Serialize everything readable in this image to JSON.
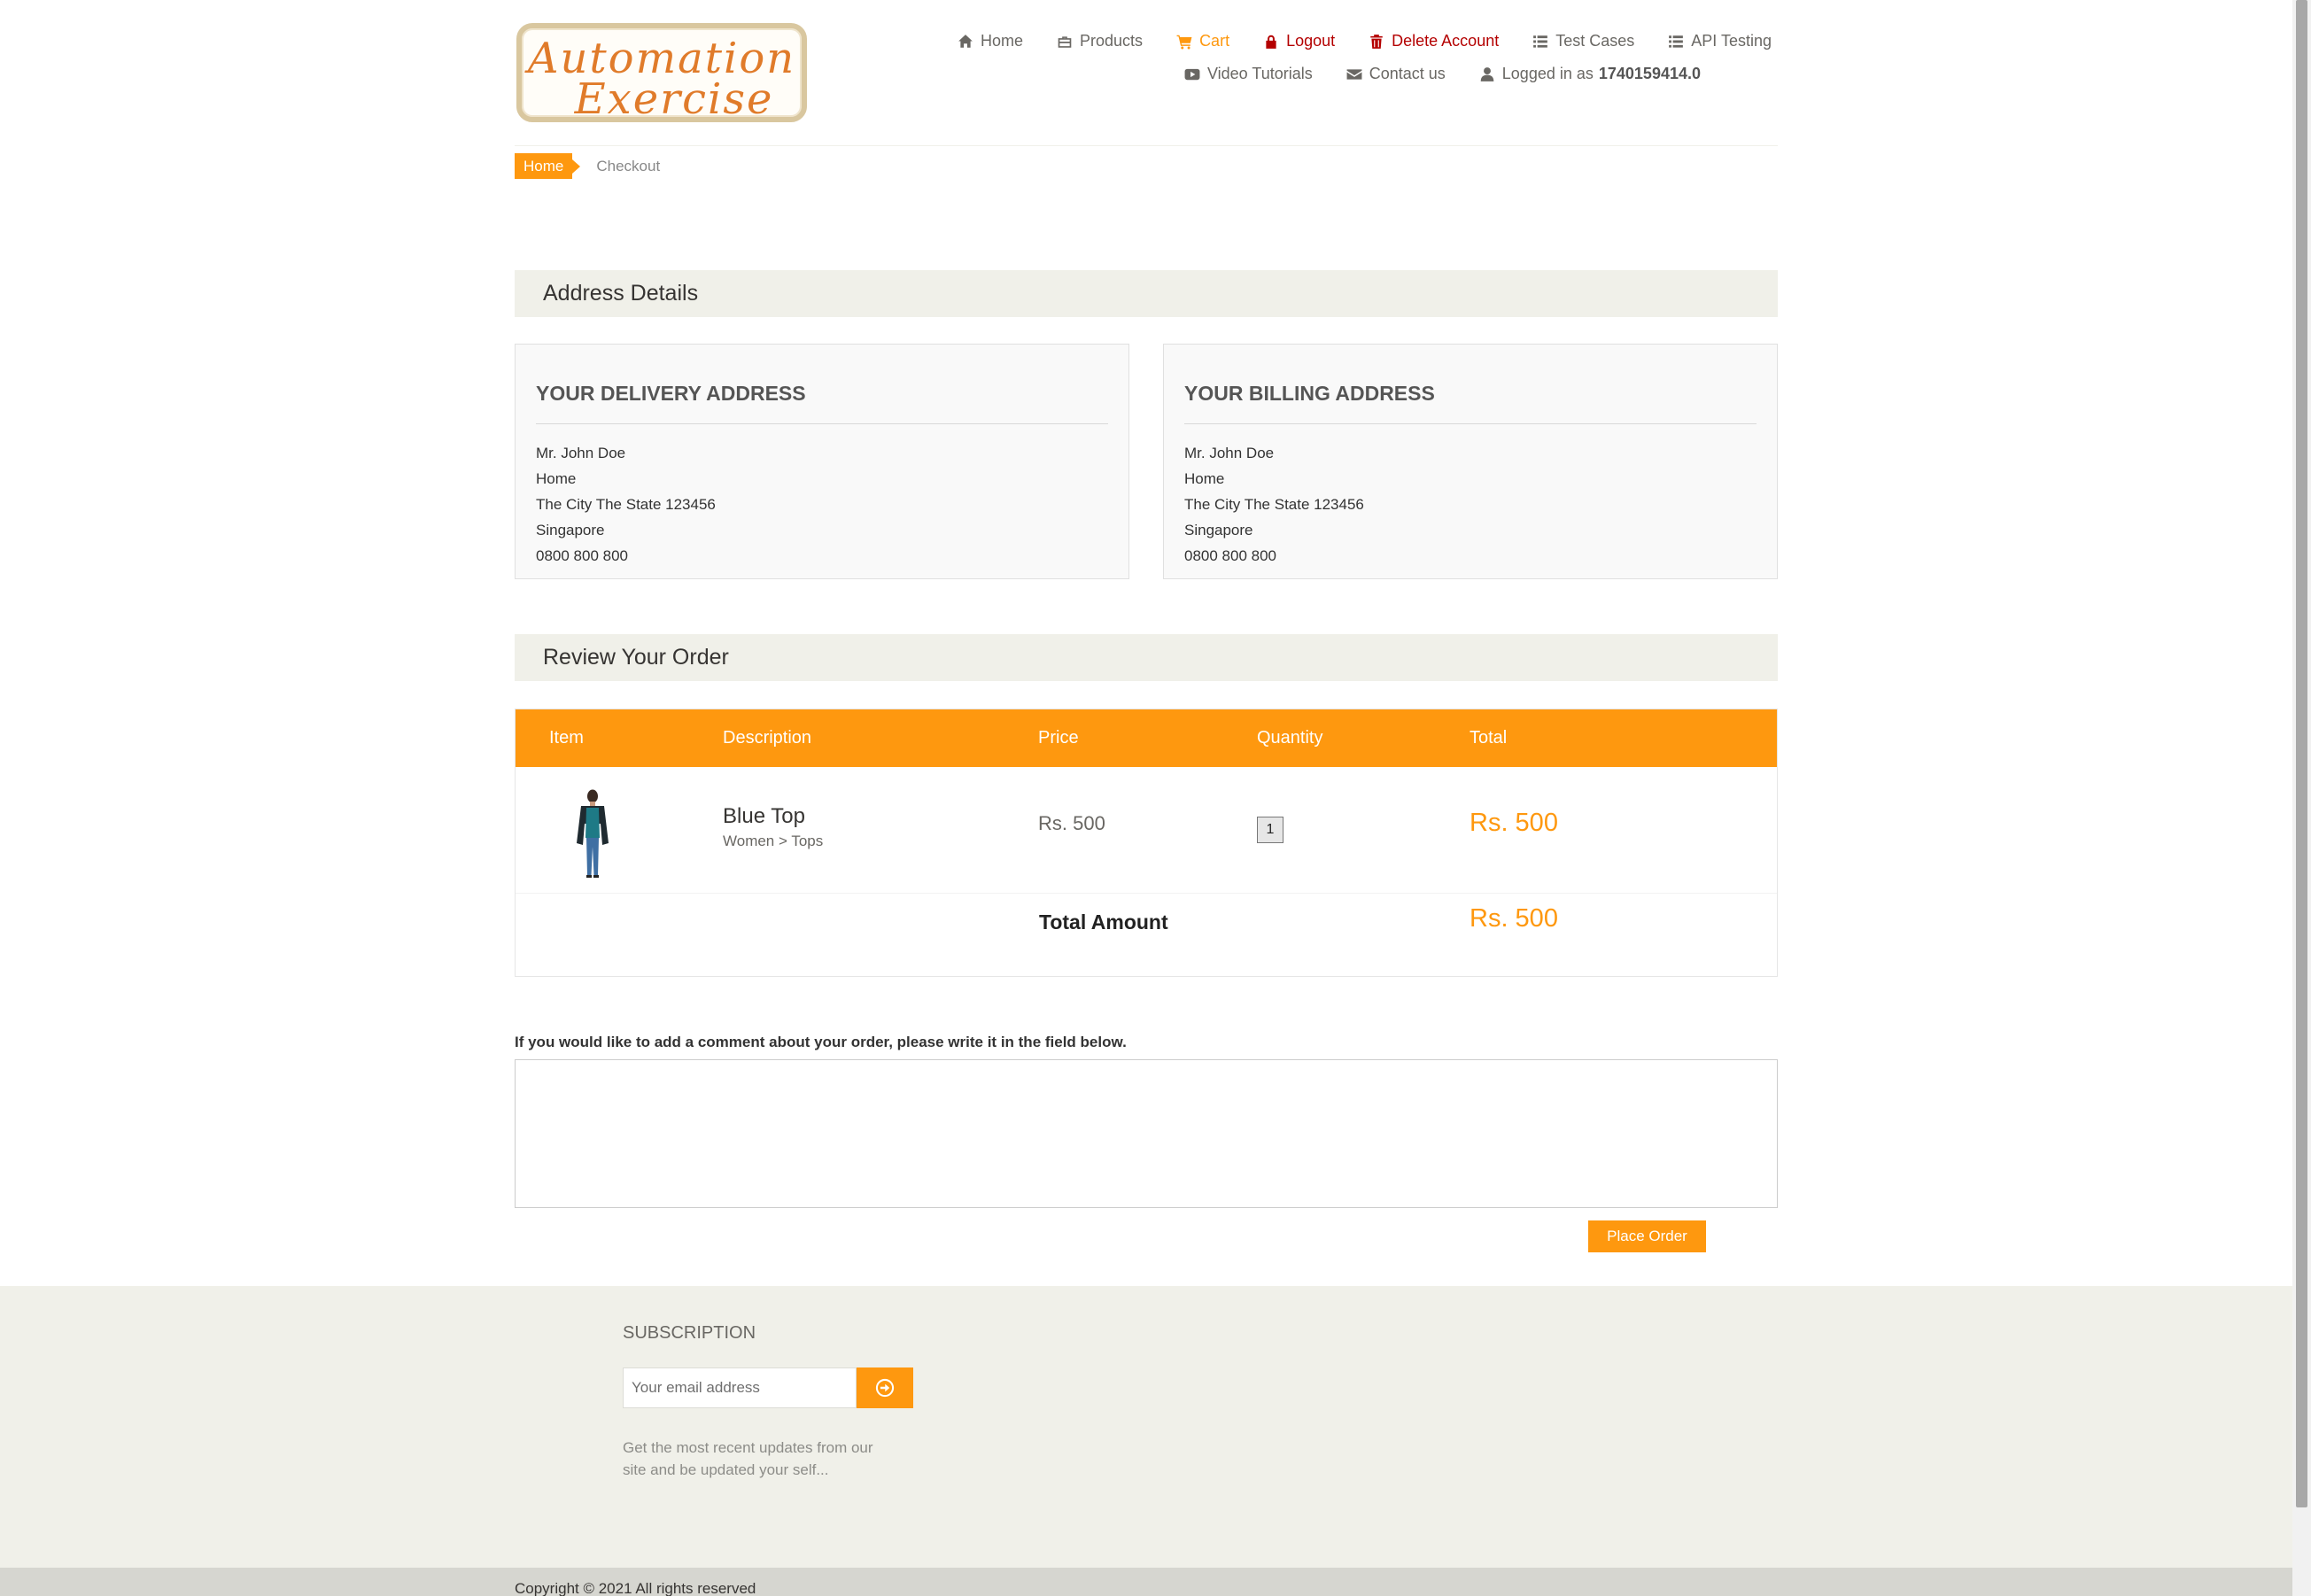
{
  "logo": {
    "line1": "Automation",
    "line2": "Exercise"
  },
  "nav": {
    "home": "Home",
    "products": "Products",
    "cart": "Cart",
    "logout": "Logout",
    "delete_account": "Delete Account",
    "test_cases": "Test Cases",
    "api_testing": "API Testing",
    "video_tutorials": "Video Tutorials",
    "contact_us": "Contact us",
    "logged_in_prefix": "Logged in as",
    "username": "1740159414.0"
  },
  "breadcrumb": {
    "home": "Home",
    "current": "Checkout"
  },
  "address_section": {
    "title": "Address Details",
    "delivery": {
      "title": "YOUR DELIVERY ADDRESS",
      "lines": [
        "Mr. John Doe",
        "Home",
        "The City The State 123456",
        "Singapore",
        "0800 800 800"
      ]
    },
    "billing": {
      "title": "YOUR BILLING ADDRESS",
      "lines": [
        "Mr. John Doe",
        "Home",
        "The City The State 123456",
        "Singapore",
        "0800 800 800"
      ]
    }
  },
  "review_section": {
    "title": "Review Your Order",
    "columns": [
      "Item",
      "Description",
      "Price",
      "Quantity",
      "Total"
    ],
    "items": [
      {
        "name": "Blue Top",
        "category": "Women > Tops",
        "price": "Rs. 500",
        "quantity": "1",
        "total": "Rs. 500"
      }
    ],
    "total_label": "Total Amount",
    "total_value": "Rs. 500"
  },
  "comment": {
    "label": "If you would like to add a comment about your order, please write it in the field below.",
    "value": ""
  },
  "place_order": "Place Order",
  "footer": {
    "subscription_title": "SUBSCRIPTION",
    "email_placeholder": "Your email address",
    "description": "Get the most recent updates from our site and be updated your self...",
    "copyright": "Copyright © 2021 All rights reserved"
  },
  "colors": {
    "accent": "#FE980F",
    "danger": "#b40000",
    "panel": "#F0F0E9"
  }
}
